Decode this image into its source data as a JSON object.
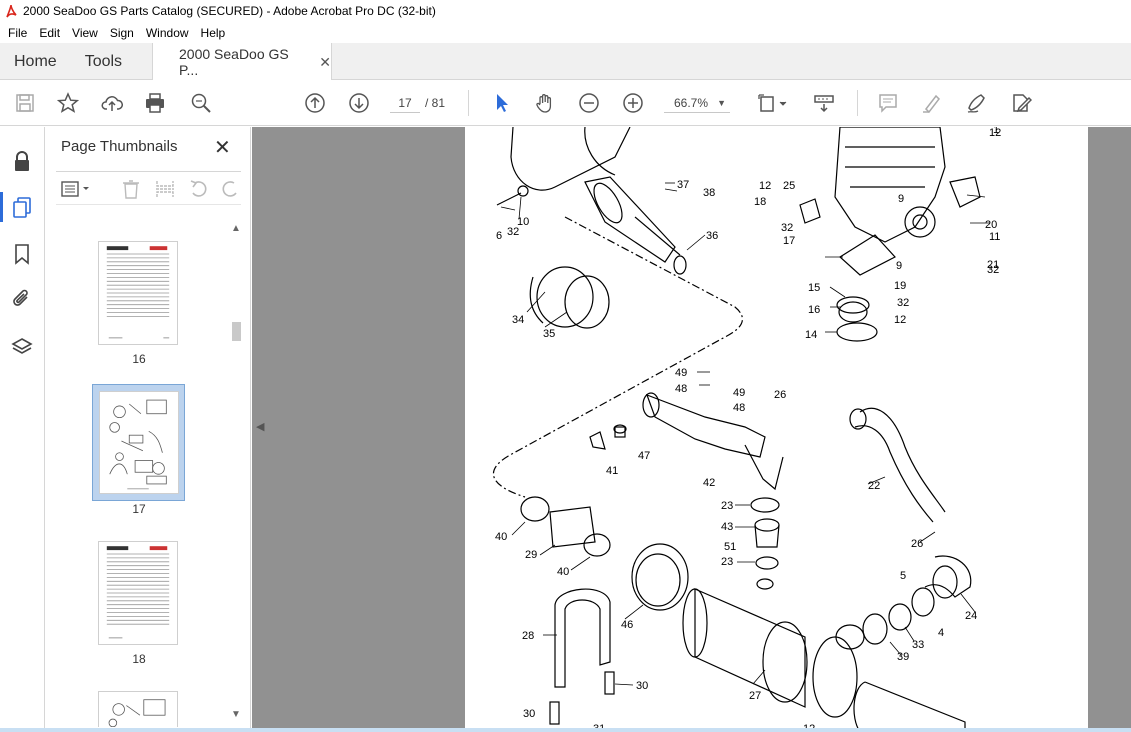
{
  "window": {
    "title": "2000 SeaDoo GS Parts Catalog (SECURED) - Adobe Acrobat Pro DC (32-bit)"
  },
  "menu": [
    "File",
    "Edit",
    "View",
    "Sign",
    "Window",
    "Help"
  ],
  "tabs": {
    "home": "Home",
    "tools": "Tools",
    "document": "2000 SeaDoo GS P...",
    "close_glyph": "✕"
  },
  "toolbar": {
    "current_page": "17",
    "page_total": "/ 81",
    "zoom": "66.7%"
  },
  "panel": {
    "title": "Page Thumbnails",
    "close_glyph": "✕",
    "thumbnails": [
      {
        "label": "16",
        "selected": false
      },
      {
        "label": "17",
        "selected": true
      },
      {
        "label": "18",
        "selected": false
      },
      {
        "label": "",
        "selected": false
      }
    ]
  },
  "diagram": {
    "callouts": [
      "1",
      "6",
      "10",
      "32",
      "37",
      "38",
      "36",
      "34",
      "35",
      "12",
      "25",
      "18",
      "32",
      "17",
      "9",
      "12",
      "9",
      "20",
      "11",
      "21",
      "32",
      "15",
      "19",
      "32",
      "16",
      "12",
      "14",
      "49",
      "48",
      "49",
      "48",
      "26",
      "41",
      "47",
      "42",
      "22",
      "23",
      "43",
      "51",
      "23",
      "40",
      "29",
      "40",
      "26",
      "5",
      "24",
      "46",
      "28",
      "4",
      "33",
      "39",
      "30",
      "27",
      "30",
      "12",
      "31"
    ]
  },
  "colors": {
    "accent": "#2d6cd9",
    "doc_background": "#919191",
    "selected_thumb": "#bcd3ee"
  }
}
